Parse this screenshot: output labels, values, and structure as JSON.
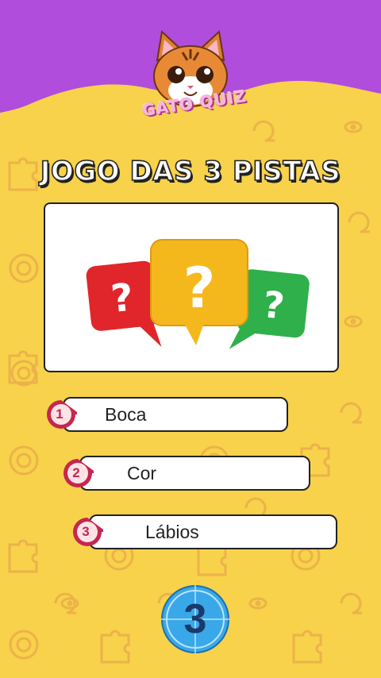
{
  "header": {
    "logo_text": "GATO QUIZ"
  },
  "title": "JOGO DAS 3 PISTAS",
  "hints": [
    {
      "number": "1",
      "text": "Boca"
    },
    {
      "number": "2",
      "text": "Cor"
    },
    {
      "number": "3",
      "text": "Lábios"
    }
  ],
  "timer": {
    "value": "3"
  },
  "icons": [
    "cat-mascot-icon",
    "question-bubble-icon",
    "puzzle-piece-icon",
    "lifebuoy-icon"
  ],
  "colors": {
    "top": "#b04ddc",
    "background": "#f7d24a",
    "accent": "#c6264f",
    "timer": "#39a8e8"
  }
}
